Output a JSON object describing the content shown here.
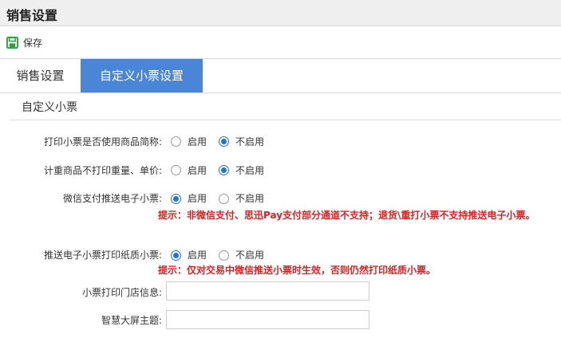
{
  "header": {
    "title": "销售设置"
  },
  "toolbar": {
    "save_label": "保存"
  },
  "tabs": [
    {
      "label": "销售设置",
      "active": false
    },
    {
      "label": "自定义小票设置",
      "active": true
    }
  ],
  "section": {
    "title": "自定义小票"
  },
  "options": {
    "enable": "启用",
    "disable": "不启用"
  },
  "settings": [
    {
      "label": "打印小票是否使用商品简称:",
      "selected": "disable"
    },
    {
      "label": "计重商品不打印重量、单价:",
      "selected": "disable"
    },
    {
      "label": "微信支付推送电子小票:",
      "selected": "enable",
      "hint": "提示：非微信支付、思迅Pay支付部分通道不支持；退货\\重打小票不支持推送电子小票。"
    },
    {
      "label": "推送电子小票打印纸质小票:",
      "selected": "enable",
      "hint": "提示：仅对交易中微信推送小票时生效，否则仍然打印纸质小票。"
    }
  ],
  "fields": [
    {
      "label": "小票打印门店信息:",
      "value": ""
    },
    {
      "label": "智慧大屏主题:",
      "value": ""
    }
  ],
  "colors": {
    "accent": "#4a86d8",
    "radio": "#1a73e8",
    "hint": "#e02020"
  }
}
